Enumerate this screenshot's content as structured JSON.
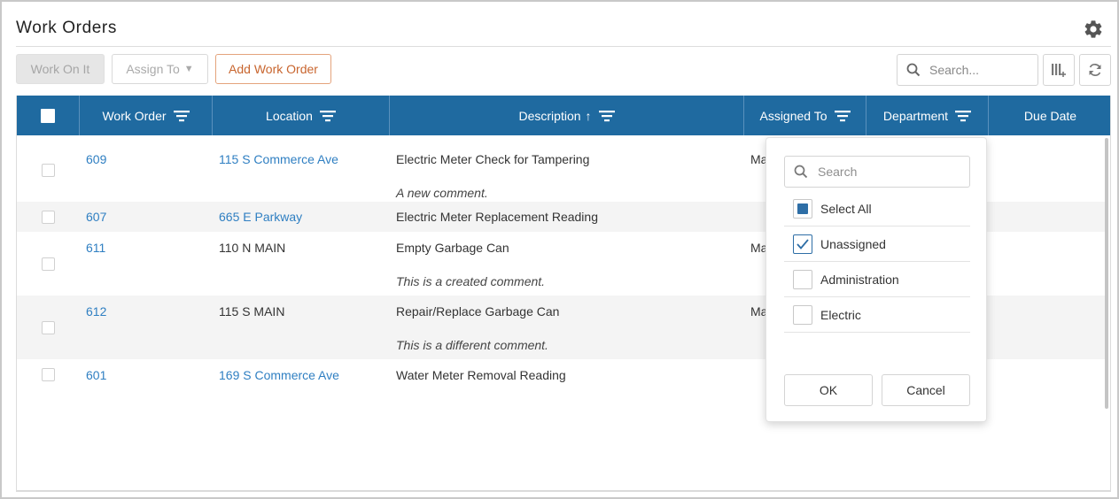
{
  "page": {
    "title": "Work Orders"
  },
  "toolbar": {
    "work_on_it_label": "Work On It",
    "assign_to_label": "Assign To",
    "assign_to_caret": "▼",
    "add_work_order_label": "Add Work Order",
    "search_placeholder": "Search...",
    "search_value": ""
  },
  "grid": {
    "columns": {
      "work_order": "Work Order",
      "location": "Location",
      "description": "Description",
      "description_sort": "↑",
      "assigned_to": "Assigned To",
      "department": "Department",
      "due_date": "Due Date"
    },
    "rows": [
      {
        "work_order": "609",
        "location": "115 S Commerce Ave",
        "location_link": true,
        "description": "Electric Meter Check for Tampering",
        "assigned_to": "Ma",
        "comment": "A new comment."
      },
      {
        "work_order": "607",
        "location": "665 E Parkway",
        "location_link": true,
        "description": "Electric Meter Replacement Reading",
        "assigned_to": "",
        "comment": ""
      },
      {
        "work_order": "611",
        "location": "110 N MAIN",
        "location_link": false,
        "description": "Empty Garbage Can",
        "assigned_to": "Ma",
        "comment": "This is a created comment."
      },
      {
        "work_order": "612",
        "location": "115 S MAIN",
        "location_link": false,
        "description": "Repair/Replace Garbage Can",
        "assigned_to": "Ma",
        "comment": "This is a different comment."
      },
      {
        "work_order": "601",
        "location": "169 S Commerce Ave",
        "location_link": true,
        "description": "Water Meter Removal Reading",
        "assigned_to": "",
        "comment": ""
      }
    ]
  },
  "filter_popup": {
    "search_placeholder": "Search",
    "search_value": "",
    "options": [
      {
        "label": "Select All",
        "state": "indeterminate"
      },
      {
        "label": "Unassigned",
        "state": "checked"
      },
      {
        "label": "Administration",
        "state": "unchecked"
      },
      {
        "label": "Electric",
        "state": "unchecked"
      }
    ],
    "ok_label": "OK",
    "cancel_label": "Cancel"
  },
  "colors": {
    "header_bg": "#1f6aa0",
    "link": "#2f7fc2",
    "accent_button": "#c8652e",
    "checkbox_accent": "#2e6ea6"
  },
  "icons": {
    "settings": "gear-icon",
    "search": "search-icon",
    "columns": "column-chooser-icon",
    "refresh": "refresh-icon",
    "filter": "filter-icon"
  }
}
